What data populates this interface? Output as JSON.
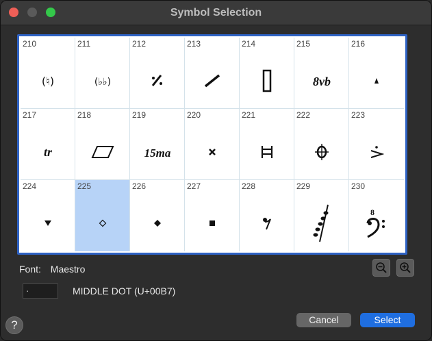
{
  "window": {
    "title": "Symbol Selection"
  },
  "cells": [
    {
      "num": "210",
      "glyph": "natural-paren-icon"
    },
    {
      "num": "211",
      "glyph": "double-flat-paren-icon"
    },
    {
      "num": "212",
      "glyph": "repeat-bar-icon"
    },
    {
      "num": "213",
      "glyph": "slash-icon"
    },
    {
      "num": "214",
      "glyph": "rectangle-notehead-icon"
    },
    {
      "num": "215",
      "glyph": "ottava-bassa-icon",
      "text": "8vb"
    },
    {
      "num": "216",
      "glyph": "staccatissimo-icon"
    },
    {
      "num": "217",
      "glyph": "trill-icon",
      "text": "tr"
    },
    {
      "num": "218",
      "glyph": "parallelogram-icon"
    },
    {
      "num": "219",
      "glyph": "quindicesima-icon",
      "text": "15ma"
    },
    {
      "num": "220",
      "glyph": "x-notehead-icon"
    },
    {
      "num": "221",
      "glyph": "h-bracket-icon"
    },
    {
      "num": "222",
      "glyph": "coda-icon"
    },
    {
      "num": "223",
      "glyph": "accent-dot-icon"
    },
    {
      "num": "224",
      "glyph": "down-triangle-icon"
    },
    {
      "num": "225",
      "glyph": "small-diamond-icon"
    },
    {
      "num": "226",
      "glyph": "filled-diamond-icon"
    },
    {
      "num": "227",
      "glyph": "square-notehead-icon"
    },
    {
      "num": "228",
      "glyph": "eighth-rest-icon"
    },
    {
      "num": "229",
      "glyph": "grace-run-icon"
    },
    {
      "num": "230",
      "glyph": "bass-clef-8-icon",
      "text": "8"
    }
  ],
  "selected_index": 15,
  "font": {
    "label": "Font:",
    "name": "Maestro"
  },
  "character": {
    "value": "·",
    "name": "MIDDLE DOT (U+00B7)"
  },
  "buttons": {
    "cancel": "Cancel",
    "select": "Select",
    "help": "?"
  },
  "colors": {
    "accent": "#1f6ee0",
    "selection": "#b7d3f7",
    "frame": "#2e62c4"
  }
}
